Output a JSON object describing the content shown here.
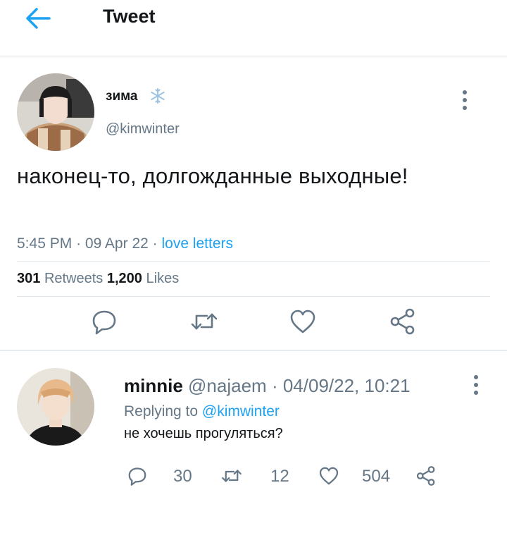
{
  "header": {
    "title": "Tweet",
    "back_icon": "arrow-left-icon"
  },
  "tweet": {
    "display_name": "зима",
    "name_icon": "snowflake-icon",
    "handle": "@kimwinter",
    "text": "наконец-то, долгожданные выходные!",
    "time": "5:45 PM",
    "date": "09 Apr 22",
    "source": "love letters",
    "retweets": "301",
    "retweets_label": "Retweets",
    "likes": "1,200",
    "likes_label": "Likes",
    "actions": [
      "reply-icon",
      "retweet-icon",
      "like-icon",
      "share-icon"
    ]
  },
  "reply": {
    "name": "minnie",
    "handle": "@najaem",
    "separator": "·",
    "timestamp": "04/09/22, 10:21",
    "replying_prefix": "Replying to",
    "replying_to": "@kimwinter",
    "text": "не хочешь прогуляться?",
    "replies": "30",
    "retweets": "12",
    "likes": "504"
  },
  "colors": {
    "accent": "#1da1f2",
    "muted": "#657786",
    "text": "#14171a",
    "divider": "#e1e8ed"
  }
}
